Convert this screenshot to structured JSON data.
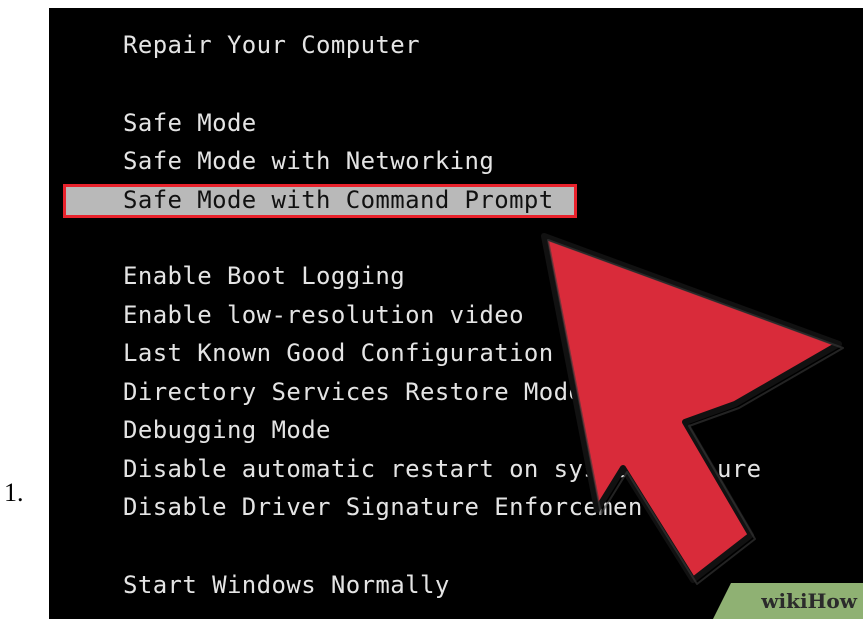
{
  "list_number": "1.",
  "boot_menu": {
    "title": "Repair Your Computer",
    "items": [
      "Safe Mode",
      "Safe Mode with Networking",
      "Safe Mode with Command Prompt",
      "Enable Boot Logging",
      "Enable low-resolution video",
      "Last Known Good Configuration",
      "Directory Services Restore Mode",
      "Debugging Mode",
      "Disable automatic restart on system failure",
      "Disable Driver Signature Enforcement",
      "Start Windows Normally"
    ],
    "selected_index": 2
  },
  "colors": {
    "background": "#000000",
    "text": "#e4e4e4",
    "highlight": "#b9b9b9",
    "border": "#e8222c",
    "arrow": "#d92b3a"
  },
  "watermark": {
    "text": "wikiHow"
  }
}
